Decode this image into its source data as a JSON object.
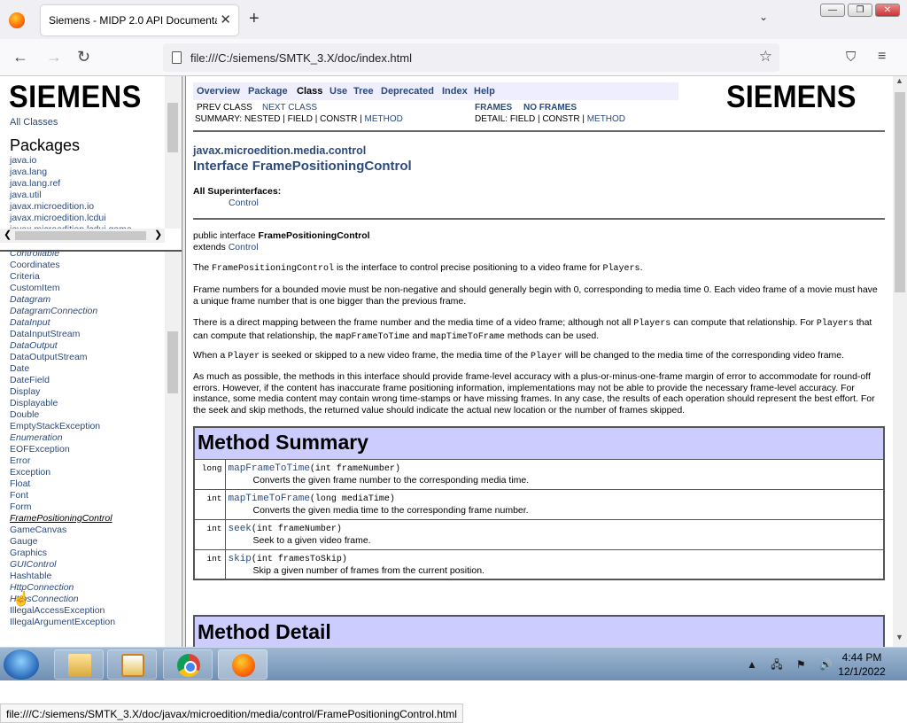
{
  "browser": {
    "tab_title": "Siemens - MIDP 2.0 API Documentat",
    "tab_close": "✕",
    "new_tab": "+",
    "tab_list": "⌄",
    "url": "file:///C:/siemens/SMTK_3.X/doc/index.html",
    "window_min": "—",
    "window_restore": "❐",
    "window_close": "✕"
  },
  "left_top": {
    "logo": "SIEMENS",
    "all_classes": "All Classes",
    "packages_heading": "Packages",
    "packages": [
      "java.io",
      "java.lang",
      "java.lang.ref",
      "java.util",
      "javax.microedition.io",
      "javax.microedition.lcdui",
      "javax.microedition.lcdui.game"
    ]
  },
  "left_bottom": {
    "classes": [
      {
        "name": "Controllable",
        "style": "i"
      },
      {
        "name": "Coordinates",
        "style": ""
      },
      {
        "name": "Criteria",
        "style": ""
      },
      {
        "name": "CustomItem",
        "style": ""
      },
      {
        "name": "Datagram",
        "style": "i"
      },
      {
        "name": "DatagramConnection",
        "style": "i"
      },
      {
        "name": "DataInput",
        "style": "i"
      },
      {
        "name": "DataInputStream",
        "style": ""
      },
      {
        "name": "DataOutput",
        "style": "i"
      },
      {
        "name": "DataOutputStream",
        "style": ""
      },
      {
        "name": "Date",
        "style": ""
      },
      {
        "name": "DateField",
        "style": ""
      },
      {
        "name": "Display",
        "style": ""
      },
      {
        "name": "Displayable",
        "style": ""
      },
      {
        "name": "Double",
        "style": ""
      },
      {
        "name": "EmptyStackException",
        "style": ""
      },
      {
        "name": "Enumeration",
        "style": "i"
      },
      {
        "name": "EOFException",
        "style": ""
      },
      {
        "name": "Error",
        "style": ""
      },
      {
        "name": "Exception",
        "style": ""
      },
      {
        "name": "Float",
        "style": ""
      },
      {
        "name": "Font",
        "style": ""
      },
      {
        "name": "Form",
        "style": ""
      },
      {
        "name": "FramePositioningControl",
        "style": "u"
      },
      {
        "name": "GameCanvas",
        "style": ""
      },
      {
        "name": "Gauge",
        "style": ""
      },
      {
        "name": "Graphics",
        "style": ""
      },
      {
        "name": "GUIControl",
        "style": "i"
      },
      {
        "name": "Hashtable",
        "style": ""
      },
      {
        "name": "HttpConnection",
        "style": "i"
      },
      {
        "name": "HttpsConnection",
        "style": "i"
      },
      {
        "name": "IllegalAccessException",
        "style": ""
      },
      {
        "name": "IllegalArgumentException",
        "style": ""
      }
    ]
  },
  "doc": {
    "nav": {
      "overview": "Overview",
      "package": "Package",
      "class": "Class",
      "use": "Use",
      "tree": "Tree",
      "deprecated": "Deprecated",
      "index": "Index",
      "help": "Help"
    },
    "prev_class": "PREV CLASS",
    "next_class": "NEXT CLASS",
    "frames": "FRAMES",
    "no_frames": "NO FRAMES",
    "summary_prefix": "SUMMARY: NESTED | FIELD | CONSTR | ",
    "summary_method": "METHOD",
    "detail_prefix": "DETAIL: FIELD | CONSTR | ",
    "detail_method": "METHOD",
    "logo": "SIEMENS",
    "package_name": "javax.microedition.media.control",
    "interface_title": "Interface FramePositioningControl",
    "superinterfaces_label": "All Superinterfaces:",
    "superinterface": "Control",
    "decl_prefix": "public interface ",
    "decl_name": "FramePositioningControl",
    "extends_label": "extends ",
    "extends_name": "Control",
    "p1": {
      "code1": "FramePositioningControl",
      "text": " is the interface to control precise positioning to a video frame for ",
      "code2": "Players",
      "end": "."
    },
    "p2": "Frame numbers for a bounded movie must be non-negative and should generally begin with 0, corresponding to media time 0. Each video frame of a movie must have a unique frame number that is one bigger than the previous frame.",
    "p3": {
      "a": "There is a direct mapping between the frame number and the media time of a video frame; although not all ",
      "c1": "Players",
      "b": " can compute that relationship. For ",
      "c2": "Players",
      "c": " that can compute that relationship, the ",
      "c3": "mapFrameToTime",
      "d": " and ",
      "c4": "mapTimeToFrame",
      "e": " methods can be used."
    },
    "p4": {
      "a": "When a ",
      "c1": "Player",
      "b": " is seeked or skipped to a new video frame, the media time of the ",
      "c2": "Player",
      "c": " will be changed to the media time of the corresponding video frame."
    },
    "p5": "As much as possible, the methods in this interface should provide frame-level accuracy with a plus-or-minus-one-frame margin of error to accommodate for round-off errors. However, if the content has inaccurate frame positioning information, implementations may not be able to provide the necessary frame-level accuracy. For instance, some media content may contain wrong time-stamps or have missing frames. In any case, the results of each operation should represent the best effort. For the seek and skip methods, the returned value should indicate the actual new location or the number of frames skipped.",
    "method_summary_title": "Method Summary",
    "methods": [
      {
        "type": "long",
        "name": "mapFrameToTime",
        "params": "(int frameNumber)",
        "desc": "Converts the given frame number to the corresponding media time."
      },
      {
        "type": "int",
        "name": "mapTimeToFrame",
        "params": "(long mediaTime)",
        "desc": "Converts the given media time to the corresponding frame number."
      },
      {
        "type": "int",
        "name": "seek",
        "params": "(int frameNumber)",
        "desc": "Seek to a given video frame."
      },
      {
        "type": "int",
        "name": "skip",
        "params": "(int framesToSkip)",
        "desc": "Skip a given number of frames from the current position."
      }
    ],
    "method_detail_title": "Method Detail"
  },
  "status_url": "file:///C:/siemens/SMTK_3.X/doc/javax/microedition/media/control/FramePositioningControl.html",
  "taskbar": {
    "time": "4:44 PM",
    "date": "12/1/2022",
    "tray": "▲ 🖧 ⚑ 🔊"
  }
}
